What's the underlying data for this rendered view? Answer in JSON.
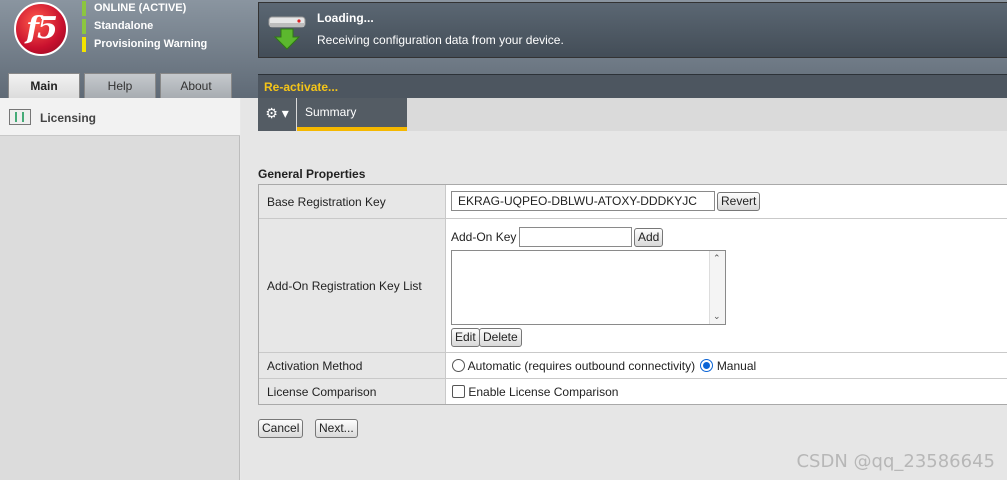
{
  "header": {
    "logo_text": "f5",
    "status": [
      "ONLINE (ACTIVE)",
      "Standalone",
      "Provisioning Warning"
    ],
    "loading_title": "Loading...",
    "loading_message": "Receiving configuration data from your device.",
    "reactivate_label": "Re-activate..."
  },
  "tabs": [
    {
      "label": "Main",
      "active": true
    },
    {
      "label": "Help",
      "active": false
    },
    {
      "label": "About",
      "active": false
    }
  ],
  "sidebar": {
    "items": [
      {
        "label": "Licensing",
        "icon": "license-icon"
      }
    ]
  },
  "toolbar": {
    "gear_glyph": "⚙ ▾",
    "summary_label": "Summary"
  },
  "form": {
    "section_title": "General Properties",
    "base_key_label": "Base Registration Key",
    "base_key_value": "EKRAG-UQPEO-DBLWU-ATOXY-DDDKYJC",
    "revert_label": "Revert",
    "addon_list_label": "Add-On Registration Key List",
    "addon_key_label": "Add-On Key",
    "addon_key_value": "",
    "add_label": "Add",
    "edit_label": "Edit",
    "delete_label": "Delete",
    "activation_label": "Activation Method",
    "activation_auto_label": "Automatic (requires outbound connectivity)",
    "activation_manual_label": "Manual",
    "activation_selected": "Manual",
    "comparison_label": "License Comparison",
    "comparison_option_label": "Enable License Comparison",
    "comparison_checked": false
  },
  "actions": {
    "cancel_label": "Cancel",
    "next_label": "Next..."
  },
  "watermark": "CSDN @qq_23586645",
  "colors": {
    "status_ok": "#8cc63f",
    "status_warn": "#f4e400",
    "accent": "#f5b800",
    "reactivate_text": "#f5c518"
  }
}
